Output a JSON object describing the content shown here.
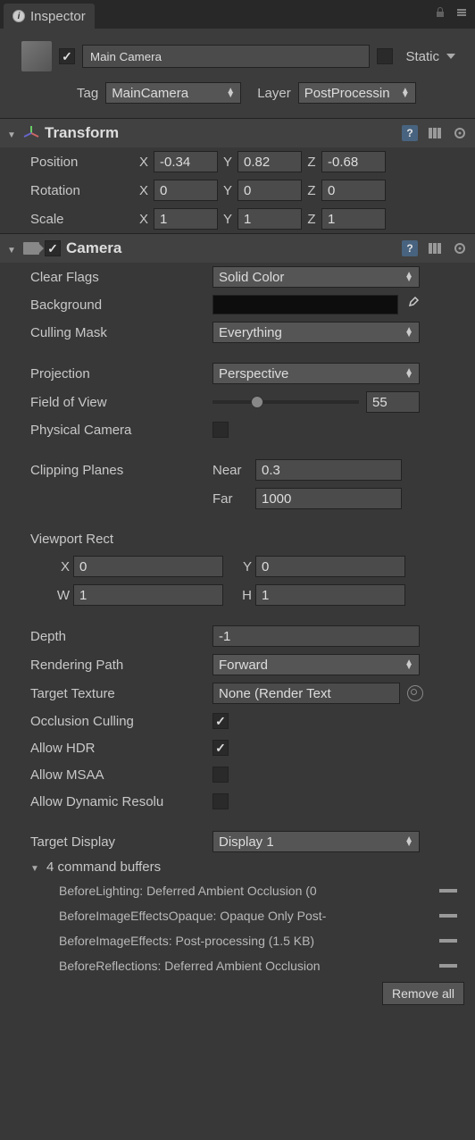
{
  "tab": {
    "title": "Inspector"
  },
  "header": {
    "name": "Main Camera",
    "name_checked": true,
    "static_label": "Static",
    "static_checked": false,
    "tag_label": "Tag",
    "tag_value": "MainCamera",
    "layer_label": "Layer",
    "layer_value": "PostProcessin"
  },
  "transform": {
    "title": "Transform",
    "position_label": "Position",
    "rotation_label": "Rotation",
    "scale_label": "Scale",
    "x": "X",
    "y": "Y",
    "z": "Z",
    "pos": {
      "x": "-0.34",
      "y": "0.82",
      "z": "-0.68"
    },
    "rot": {
      "x": "0",
      "y": "0",
      "z": "0"
    },
    "scale": {
      "x": "1",
      "y": "1",
      "z": "1"
    }
  },
  "camera": {
    "title": "Camera",
    "enabled": true,
    "clear_flags_label": "Clear Flags",
    "clear_flags_value": "Solid Color",
    "background_label": "Background",
    "culling_mask_label": "Culling Mask",
    "culling_mask_value": "Everything",
    "projection_label": "Projection",
    "projection_value": "Perspective",
    "fov_label": "Field of View",
    "fov_value": "55",
    "physical_label": "Physical Camera",
    "physical_checked": false,
    "clipping_label": "Clipping Planes",
    "near_label": "Near",
    "near_value": "0.3",
    "far_label": "Far",
    "far_value": "1000",
    "viewport_label": "Viewport Rect",
    "vx_label": "X",
    "vx": "0",
    "vy_label": "Y",
    "vy": "0",
    "vw_label": "W",
    "vw": "1",
    "vh_label": "H",
    "vh": "1",
    "depth_label": "Depth",
    "depth_value": "-1",
    "rendering_path_label": "Rendering Path",
    "rendering_path_value": "Forward",
    "target_texture_label": "Target Texture",
    "target_texture_value": "None (Render Text",
    "occlusion_label": "Occlusion Culling",
    "occlusion_checked": true,
    "hdr_label": "Allow HDR",
    "hdr_checked": true,
    "msaa_label": "Allow MSAA",
    "msaa_checked": false,
    "dynres_label": "Allow Dynamic Resolu",
    "dynres_checked": false,
    "target_display_label": "Target Display",
    "target_display_value": "Display 1",
    "cmd_header": "4 command buffers",
    "cmd_items": [
      "BeforeLighting: Deferred Ambient Occlusion (0",
      "BeforeImageEffectsOpaque: Opaque Only Post-",
      "BeforeImageEffects: Post-processing (1.5 KB)",
      "BeforeReflections: Deferred Ambient Occlusion"
    ],
    "remove_all": "Remove all"
  }
}
